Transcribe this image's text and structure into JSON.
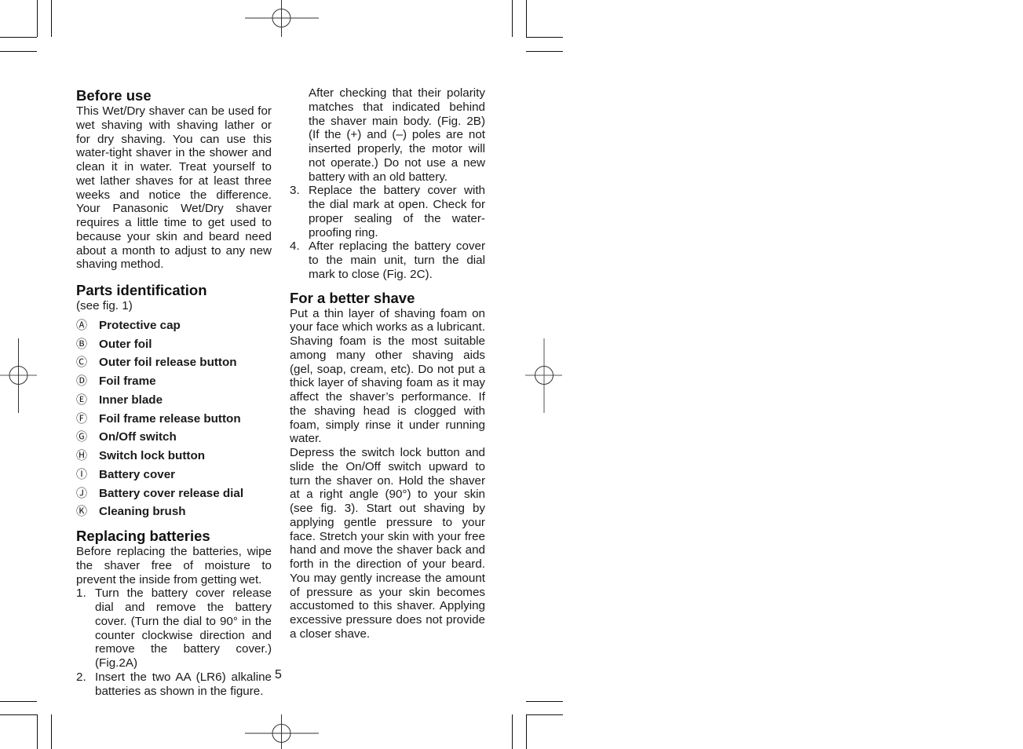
{
  "page": {
    "page_number": "5",
    "sections": {
      "before_use": {
        "heading": "Before use",
        "body": "This Wet/Dry shaver can be used for wet shaving with shaving lather or for dry shaving. You can use this water-tight shaver in the shower and clean it in water. Treat yourself to wet lather shaves for at least three weeks and notice the difference. Your Panasonic Wet/Dry shaver requires a little time to get used to because your skin and beard need about a month to adjust to any new shaving method."
      },
      "parts_identification": {
        "heading": "Parts identification",
        "subtitle": "(see fig. 1)",
        "items": [
          {
            "letter": "Ⓐ",
            "label": "Protective cap"
          },
          {
            "letter": "Ⓑ",
            "label": "Outer foil"
          },
          {
            "letter": "Ⓒ",
            "label": "Outer foil release button"
          },
          {
            "letter": "Ⓓ",
            "label": "Foil frame"
          },
          {
            "letter": "Ⓔ",
            "label": "Inner blade"
          },
          {
            "letter": "Ⓕ",
            "label": "Foil frame release button"
          },
          {
            "letter": "Ⓖ",
            "label": "On/Off switch"
          },
          {
            "letter": "Ⓗ",
            "label": "Switch lock button"
          },
          {
            "letter": "Ⓘ",
            "label": "Battery cover"
          },
          {
            "letter": "Ⓙ",
            "label": "Battery cover release dial"
          },
          {
            "letter": "Ⓚ",
            "label": "Cleaning brush"
          }
        ]
      },
      "replacing_batteries": {
        "heading": "Replacing batteries",
        "intro": "Before replacing the batteries, wipe the shaver free of moisture to prevent the inside from getting wet.",
        "steps": [
          {
            "num": "1.",
            "text": "Turn the battery cover release dial and remove the battery cover. (Turn the dial to 90° in the counter clockwise direction and remove the battery cover.) (Fig.2A)"
          },
          {
            "num": "2.",
            "text": "Insert the two AA (LR6) alkaline batteries as shown in the figure."
          }
        ],
        "step2_continued": "After checking that their polarity matches that indicated behind the shaver main body. (Fig. 2B) (If the (+) and (–) poles are not inserted properly, the motor will not operate.) Do not use a new battery with an old battery.",
        "steps_cont": [
          {
            "num": "3.",
            "text": "Replace the battery cover with the dial mark at open. Check for proper sealing of the water-proofing ring."
          },
          {
            "num": "4.",
            "text": "After replacing the battery cover to the main unit, turn the dial mark to close (Fig. 2C)."
          }
        ]
      },
      "better_shave": {
        "heading": "For a better shave",
        "para1": "Put a thin layer of shaving foam on your face which works as a lubricant. Shaving foam is the most suitable among many other shaving aids (gel, soap, cream, etc). Do not put a thick layer of shaving foam as it may affect the shaver’s performance. If the shaving head is clogged with foam, simply rinse it under running water.",
        "para2": "Depress the switch lock button and slide the On/Off switch upward to turn the shaver on. Hold the shaver at a right angle (90°) to your skin (see fig. 3). Start out shaving by applying gentle pressure to your face. Stretch your skin with your free hand and move the shaver back and forth in the direction of your beard. You may gently increase the amount of pressure as your skin becomes accustomed to this shaver. Applying excessive pressure does not provide a closer shave."
      }
    }
  }
}
